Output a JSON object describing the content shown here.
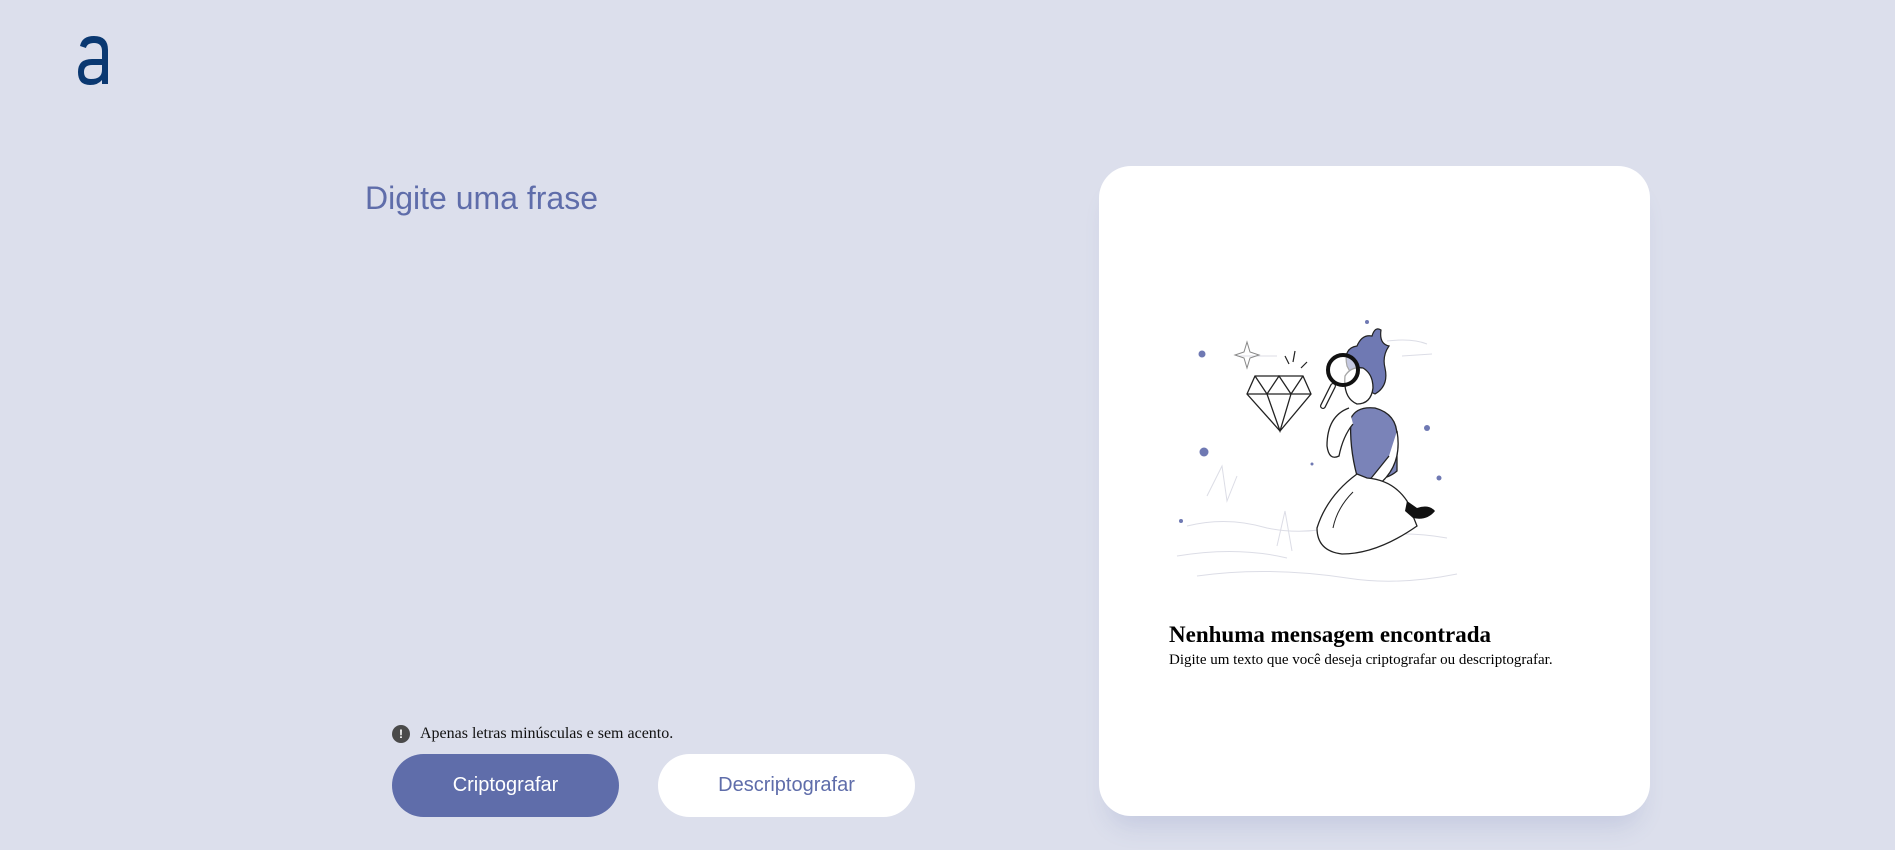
{
  "brand": {
    "logo_letter": "a",
    "color": "#0a3871"
  },
  "input": {
    "placeholder": "Digite uma frase",
    "value": ""
  },
  "hint": {
    "icon": "exclamation-circle-icon",
    "text": "Apenas letras minúsculas e sem acento."
  },
  "buttons": {
    "encrypt_label": "Criptografar",
    "decrypt_label": "Descriptografar"
  },
  "output": {
    "illustration": "person-with-magnifier-and-diamond-illustration",
    "empty_title": "Nenhuma mensagem encontrada",
    "empty_subtitle": "Digite um texto que você deseja criptografar ou descriptografar."
  },
  "colors": {
    "background": "#dcdfec",
    "accent": "#5f6daa",
    "card": "#ffffff"
  }
}
